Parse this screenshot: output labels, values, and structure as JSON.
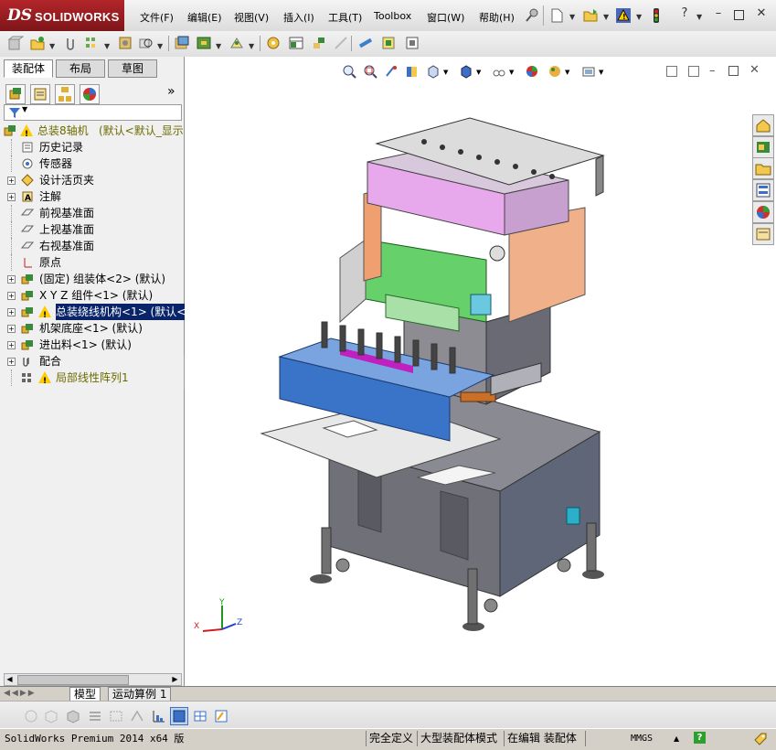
{
  "app": {
    "brand_ds": "DS",
    "brand_name": "SOLIDWORKS"
  },
  "menu": [
    "文件(F)",
    "编辑(E)",
    "视图(V)",
    "插入(I)",
    "工具(T)",
    "Toolbox",
    "窗口(W)",
    "帮助(H)"
  ],
  "panel_tabs": [
    "装配体",
    "布局",
    "草图"
  ],
  "tree": {
    "root": "总装8轴机",
    "root_config": "(默认<默认_显示",
    "items": [
      {
        "label": "历史记录",
        "icon": "history-icon",
        "expander": ""
      },
      {
        "label": "传感器",
        "icon": "sensor-icon",
        "expander": ""
      },
      {
        "label": "设计活页夹",
        "icon": "design-binder-icon",
        "expander": "+"
      },
      {
        "label": "注解",
        "icon": "annotation-icon",
        "expander": "+"
      },
      {
        "label": "前视基准面",
        "icon": "plane-icon",
        "expander": ""
      },
      {
        "label": "上视基准面",
        "icon": "plane-icon",
        "expander": ""
      },
      {
        "label": "右视基准面",
        "icon": "plane-icon",
        "expander": ""
      },
      {
        "label": "原点",
        "icon": "origin-icon",
        "expander": ""
      },
      {
        "label": "(固定) 组装体<2> (默认)",
        "icon": "subassembly-icon",
        "expander": "+"
      },
      {
        "label": "X Y Z 组件<1> (默认)",
        "icon": "subassembly-icon",
        "expander": "+"
      },
      {
        "label": "总装绕线机构<1> (默认<默",
        "icon": "subassembly-icon",
        "expander": "+",
        "selected": true,
        "warning": true
      },
      {
        "label": "机架底座<1> (默认)",
        "icon": "subassembly-icon",
        "expander": "+"
      },
      {
        "label": "进出料<1> (默认)",
        "icon": "subassembly-icon",
        "expander": "+"
      },
      {
        "label": "配合",
        "icon": "mates-icon",
        "expander": "+"
      },
      {
        "label": "局部线性阵列1",
        "icon": "linear-pattern-icon",
        "expander": "",
        "warning": true,
        "olive": true
      }
    ]
  },
  "axis_labels": {
    "x": "X",
    "y": "Y",
    "z": "Z"
  },
  "model_tabs": [
    "模型",
    "运动算例 1"
  ],
  "status": {
    "left": "SolidWorks Premium 2014 x64 版",
    "defined": "完全定义",
    "large_assembly": "大型装配体模式",
    "editing": "在编辑 装配体",
    "units": "MMGS",
    "help": "?"
  },
  "colors": {
    "brand_red": "#b3262b",
    "selection": "#0a246a",
    "warning": "#ffcc00",
    "tree_olive": "#6b6b00"
  }
}
